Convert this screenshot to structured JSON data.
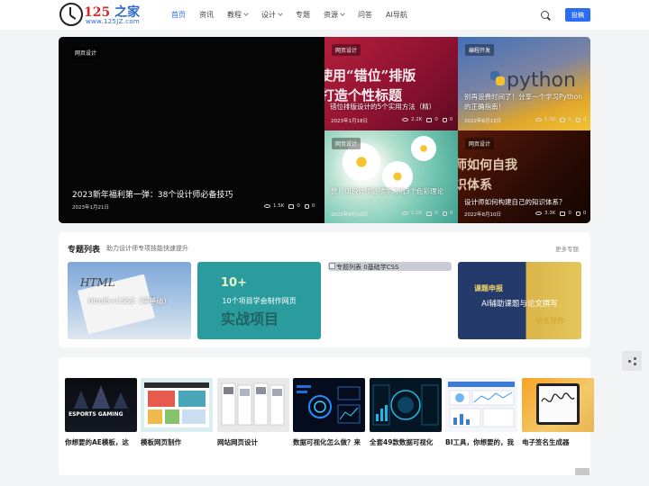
{
  "header": {
    "logo": {
      "number": "125",
      "cn": "之家",
      "url": "www.125JZ.com"
    },
    "nav": [
      {
        "label": "首页",
        "active": true,
        "dropdown": false
      },
      {
        "label": "资讯",
        "active": false,
        "dropdown": false
      },
      {
        "label": "教程",
        "active": false,
        "dropdown": true
      },
      {
        "label": "设计",
        "active": false,
        "dropdown": true
      },
      {
        "label": "专题",
        "active": false,
        "dropdown": false
      },
      {
        "label": "资源",
        "active": false,
        "dropdown": true
      },
      {
        "label": "问答",
        "active": false,
        "dropdown": false
      },
      {
        "label": "AI导航",
        "active": false,
        "dropdown": false
      }
    ],
    "search_icon": "search-icon",
    "contribute_label": "投稿",
    "accent": "#2a6df4"
  },
  "hero": {
    "main": {
      "tag": "网页设计",
      "title": "2023新年福利第一弹：38个设计师必备技巧",
      "date": "2023年1月21日",
      "views": "1.5K",
      "comments": "0",
      "likes": "0"
    },
    "tiles": [
      {
        "tag": "网页设计",
        "image_text": [
          "使用“错位”排版",
          "打造个性标题"
        ],
        "title": "错位排版设计的5个实用方法（精）",
        "date": "2023年1月18日",
        "views": "2.2K",
        "comments": "0",
        "likes": "0"
      },
      {
        "tag": "编程开发",
        "image_text": [
          "python"
        ],
        "title": "别再浪费时间了！分享一个学习Python的正确指南！",
        "date": "2022年8月13日",
        "views": "1.5K",
        "comments": "0",
        "likes": "0"
      },
      {
        "tag": "网页设计",
        "image_text": [],
        "title": "赞！UI设计师必须学习的3个色彩理论",
        "date": "2022年8月10日",
        "views": "1.0K",
        "comments": "0",
        "likes": "0"
      },
      {
        "tag": "网页设计",
        "image_text": [
          "师如何自我",
          "识体系"
        ],
        "title": "设计师如何构建自己的知识体系？",
        "date": "2022年8月10日",
        "views": "3.3K",
        "comments": "0",
        "likes": "0"
      }
    ]
  },
  "topics": {
    "title": "专题列表",
    "subtitle": "助力设计师专项技能快速提升",
    "more": "更多专题",
    "cards": [
      {
        "caption": "Html5+CSS3（零基础）",
        "image_text": "HTML"
      },
      {
        "caption": "10个项目学会制作网页",
        "image_text": [
          "10+",
          "实战项目"
        ]
      },
      {
        "caption": "0基础学CSS",
        "image_text": "专题列表"
      },
      {
        "caption": "AI辅助课题与论文撰写",
        "image_text": [
          "课题申报",
          "论文写作"
        ]
      }
    ]
  },
  "gallery": {
    "items": [
      {
        "caption": "你想要的AE模板，这",
        "image_text": "ESPORTS GAMING"
      },
      {
        "caption": "模板网页制作",
        "image_text": ""
      },
      {
        "caption": "网站网页设计",
        "image_text": ""
      },
      {
        "caption": "数据可视化怎么做？来",
        "image_text": ""
      },
      {
        "caption": "全套49款数据可视化",
        "image_text": ""
      },
      {
        "caption": "BI工具，你想要的，我",
        "image_text": ""
      },
      {
        "caption": "电子签名生成器",
        "image_text": ""
      }
    ]
  },
  "floating": {
    "share_icon": "share-icon"
  }
}
